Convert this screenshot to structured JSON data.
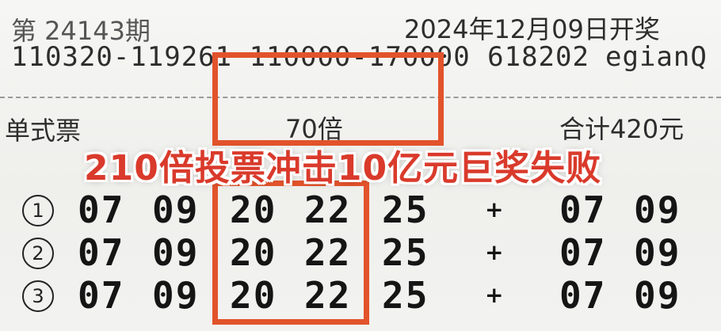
{
  "ticket": {
    "issue": "第 24143期",
    "draw_date": "2024年12月09日开奖",
    "serial": "110320-119261 110000-170000 618202",
    "check_code": "egianQ",
    "type_label": "单式票",
    "multiplier": "70倍",
    "total": "合计420元"
  },
  "headline": "210倍投票冲击10亿元巨奖失败",
  "rows": [
    {
      "index": "1",
      "front": [
        "07",
        "09",
        "20",
        "22",
        "25"
      ],
      "plus": "+",
      "back": [
        "07",
        "09"
      ]
    },
    {
      "index": "2",
      "front": [
        "07",
        "09",
        "20",
        "22",
        "25"
      ],
      "plus": "+",
      "back": [
        "07",
        "09"
      ]
    },
    {
      "index": "3",
      "front": [
        "07",
        "09",
        "20",
        "22",
        "25"
      ],
      "plus": "+",
      "back": [
        "07",
        "09"
      ]
    }
  ],
  "colors": {
    "highlight_box": "#e2532b",
    "headline_text": "#d93a2b",
    "paper": "#f3f3f1",
    "ink": "#151515"
  }
}
